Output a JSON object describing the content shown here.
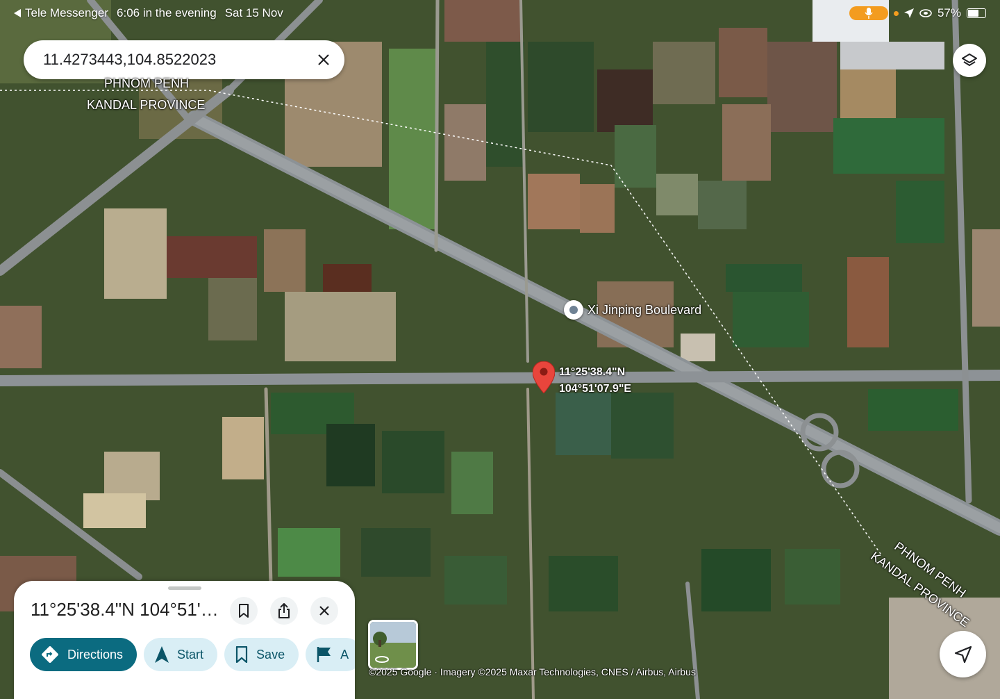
{
  "status_bar": {
    "back_app": "Tele Messenger",
    "time": "6:06 in the evening",
    "date": "Sat 15 Nov",
    "battery": "57%",
    "battery_level": 0.57
  },
  "search": {
    "query": "11.4273443,104.8522023",
    "clear_icon": "close-icon"
  },
  "map": {
    "boundary_label_top": [
      "PHNOM PENH",
      "KANDAL PROVINCE"
    ],
    "boundary_label_bottom": [
      "PHNOM PENH",
      "KANDAL PROVINCE"
    ],
    "poi_name": "Xi Jinping Boulevard",
    "pin_coords": [
      "11°25'38.4\"N",
      "104°51'07.9\"E"
    ]
  },
  "place_panel": {
    "title": "11°25'38.4\"N 104°51'0...",
    "actions": [
      {
        "label": "Directions",
        "icon": "directions-icon"
      },
      {
        "label": "Start",
        "icon": "navigation-arrow-icon"
      },
      {
        "label": "Save",
        "icon": "bookmark-icon"
      },
      {
        "label": "A",
        "icon": "flag-icon"
      }
    ]
  },
  "attribution": "©2025 Google · Imagery ©2025 Maxar Technologies, CNES / Airbus, Airbus",
  "colors": {
    "primary_button": "#0b6b80",
    "secondary_button": "#d9eef5",
    "pin": "#e8453c",
    "mic_pill": "#f39c1f"
  }
}
